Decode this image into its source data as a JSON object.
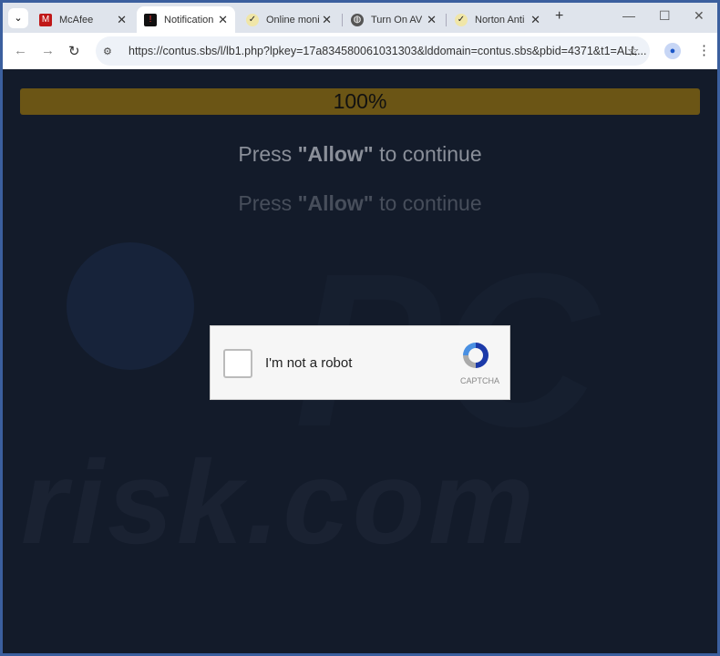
{
  "browser": {
    "tabs": [
      {
        "label": "McAfee",
        "icon": "mcafee-shield-icon",
        "active": false
      },
      {
        "label": "Notification",
        "icon": "notification-icon",
        "active": true
      },
      {
        "label": "Online moni",
        "icon": "checkmark-icon",
        "active": false
      },
      {
        "label": "Turn On AV",
        "icon": "globe-icon",
        "active": false
      },
      {
        "label": "Norton Anti",
        "icon": "checkmark-icon",
        "active": false
      }
    ],
    "url": "https://contus.sbs/l/lb1.php?lpkey=17a834580061031303&lddomain=contus.sbs&pbid=4371&t1=ALL..."
  },
  "page": {
    "progress_label": "100%",
    "progress_value": 100,
    "progress_color": "#6b5515",
    "message": {
      "prefix": "Press ",
      "bold": "\"Allow\"",
      "suffix": " to continue"
    },
    "watermark": "risk.com",
    "captcha": {
      "label": "I'm not a robot",
      "brand": "CAPTCHA"
    }
  }
}
